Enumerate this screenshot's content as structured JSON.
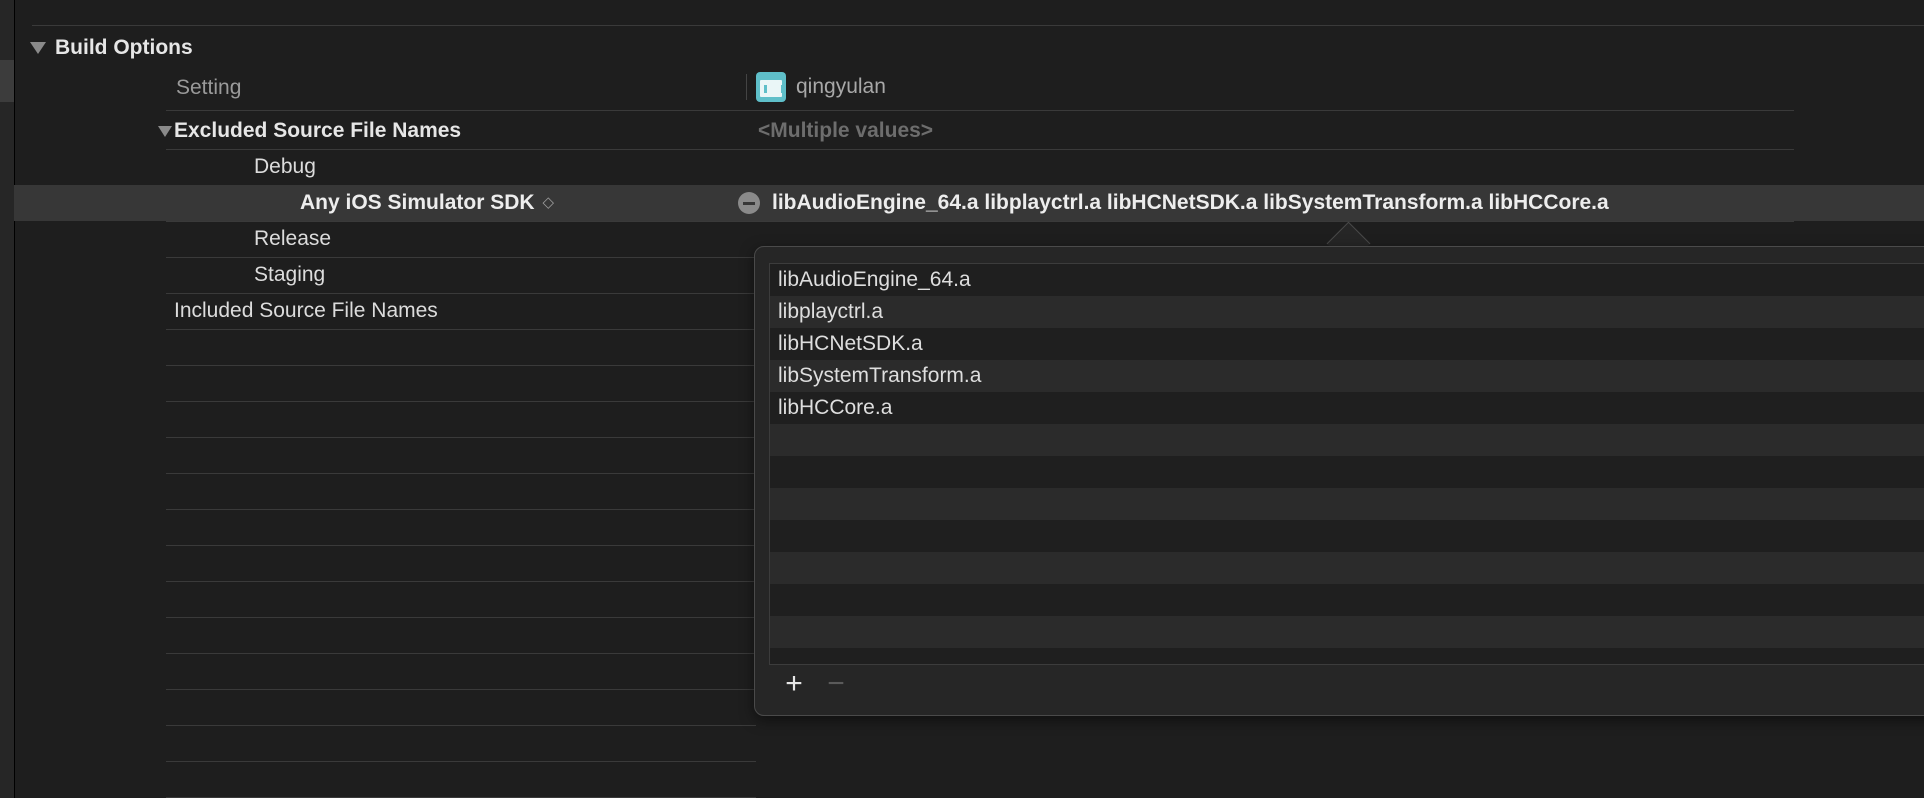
{
  "section": {
    "title": "Build Options"
  },
  "columns": {
    "setting_label": "Setting",
    "target_name": "qingyulan"
  },
  "rows": {
    "excluded": {
      "label": "Excluded Source File Names",
      "value": "<Multiple values>"
    },
    "debug": {
      "label": "Debug"
    },
    "selected": {
      "label": "Any iOS Simulator SDK",
      "selector_glyph": "◇",
      "value": "libAudioEngine_64.a libplayctrl.a libHCNetSDK.a libSystemTransform.a libHCCore.a"
    },
    "release": {
      "label": "Release"
    },
    "staging": {
      "label": "Staging"
    },
    "included": {
      "label": "Included Source File Names"
    }
  },
  "popover": {
    "items": [
      "libAudioEngine_64.a",
      "libplayctrl.a",
      "libHCNetSDK.a",
      "libSystemTransform.a",
      "libHCCore.a"
    ],
    "add_label": "+",
    "remove_label": "−"
  }
}
